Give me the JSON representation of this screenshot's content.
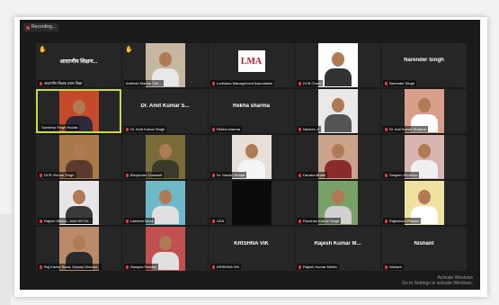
{
  "meeting": {
    "recording_label": "Recording...",
    "tiles": [
      {
        "row": 0,
        "col": 0,
        "type": "name",
        "name": "आदरणीय शिक्षण...",
        "label": "आदरणीय शिक्षक प्रसार शिक्षा",
        "hand": true,
        "muted": true
      },
      {
        "row": 0,
        "col": 1,
        "type": "video",
        "bg": "#c6b7a0",
        "shirt": "#e8e8e8",
        "label": "Ambrish Manna Shri...",
        "hand": true,
        "muted": false
      },
      {
        "row": 0,
        "col": 2,
        "type": "logo",
        "logo_text": "LMA",
        "label": "Ludhiana Management Association",
        "muted": true
      },
      {
        "row": 0,
        "col": 3,
        "type": "video",
        "bg": "#ffffff",
        "shirt": "#333333",
        "label": "DCB Choro",
        "muted": true
      },
      {
        "row": 0,
        "col": 4,
        "type": "name",
        "name": "Narender Singh",
        "label": "Narender Singh",
        "muted": true
      },
      {
        "row": 1,
        "col": 0,
        "type": "video",
        "bg": "#c44a2a",
        "shirt": "#2a2a3a",
        "label": "Sandeep Singh Hooda",
        "active": true,
        "muted": false
      },
      {
        "row": 1,
        "col": 1,
        "type": "name",
        "name": "Dr. Amit Kumar S...",
        "label": "Dr. Amit Kumar Singh",
        "muted": true
      },
      {
        "row": 1,
        "col": 2,
        "type": "name",
        "name": "Rekha sharma",
        "label": "Rekha sharma",
        "muted": true
      },
      {
        "row": 1,
        "col": 3,
        "type": "video",
        "bg": "#e9e9e9",
        "shirt": "#555555",
        "label": "Naveen Ji",
        "muted": true
      },
      {
        "row": 1,
        "col": 4,
        "type": "video",
        "bg": "#d8a08a",
        "shirt": "#ffffff",
        "label": "Dr. Anil Kumar Sharma",
        "muted": true
      },
      {
        "row": 2,
        "col": 0,
        "type": "video",
        "bg": "#a87a4a",
        "shirt": "#5a3a2a",
        "label": "DCR Vikram Singh",
        "muted": true
      },
      {
        "row": 2,
        "col": 1,
        "type": "video",
        "bg": "#7a6b3a",
        "shirt": "#3a3a2a",
        "label": "Bhupinder Cheeseit",
        "muted": true
      },
      {
        "row": 2,
        "col": 2,
        "type": "video",
        "bg": "#e8e0d8",
        "shirt": "#f5f5f5",
        "label": "Dr. Sachin Kumar",
        "muted": true
      },
      {
        "row": 2,
        "col": 3,
        "type": "video",
        "bg": "#c9a48a",
        "shirt": "#8a2a2a",
        "label": "Devaka Bharti",
        "muted": true
      },
      {
        "row": 2,
        "col": 4,
        "type": "video",
        "bg": "#d8b6b0",
        "shirt": "#f0f0f0",
        "label": "Sanjeev Khushoo",
        "muted": true
      },
      {
        "row": 3,
        "col": 0,
        "type": "video",
        "bg": "#e6e6e6",
        "shirt": "#3a3a3a",
        "label": "Rajesh Mishra, Joint HR Dir...",
        "muted": true
      },
      {
        "row": 3,
        "col": 1,
        "type": "video",
        "bg": "#6fb8c8",
        "shirt": "#e0e0e0",
        "label": "Lakshmi Deva",
        "muted": true
      },
      {
        "row": 3,
        "col": 2,
        "type": "video",
        "bg": "#0a0a0a",
        "shirt": "#111111",
        "label": "USA",
        "muted": true
      },
      {
        "row": 3,
        "col": 3,
        "type": "video",
        "bg": "#7aa06a",
        "shirt": "#d0d0d0",
        "label": "Roushan Kumar Singh",
        "muted": true
      },
      {
        "row": 3,
        "col": 4,
        "type": "video",
        "bg": "#efe2a0",
        "shirt": "#ffffff",
        "label": "Rajkishore Prasad",
        "muted": true
      },
      {
        "row": 4,
        "col": 0,
        "type": "video",
        "bg": "#b88a6a",
        "shirt": "#2a2a2a",
        "label": "Raj Kishor Rana, Deputy Director...",
        "muted": true
      },
      {
        "row": 4,
        "col": 1,
        "type": "video",
        "bg": "#c05050",
        "shirt": "#e0e0e0",
        "label": "Swapna Pandey",
        "muted": true
      },
      {
        "row": 4,
        "col": 2,
        "type": "name",
        "name": "KRISHNA VIK",
        "label": "KRISHNA VIK",
        "muted": true
      },
      {
        "row": 4,
        "col": 3,
        "type": "name",
        "name": "Rajesh Kumar M...",
        "label": "Rajesh Kumar Mehta",
        "muted": true
      },
      {
        "row": 4,
        "col": 4,
        "type": "name",
        "name": "Nishant",
        "label": "Nishant",
        "muted": true
      }
    ],
    "watermark_line1": "Activate Windows",
    "watermark_line2": "Go to Settings to activate Windows."
  }
}
